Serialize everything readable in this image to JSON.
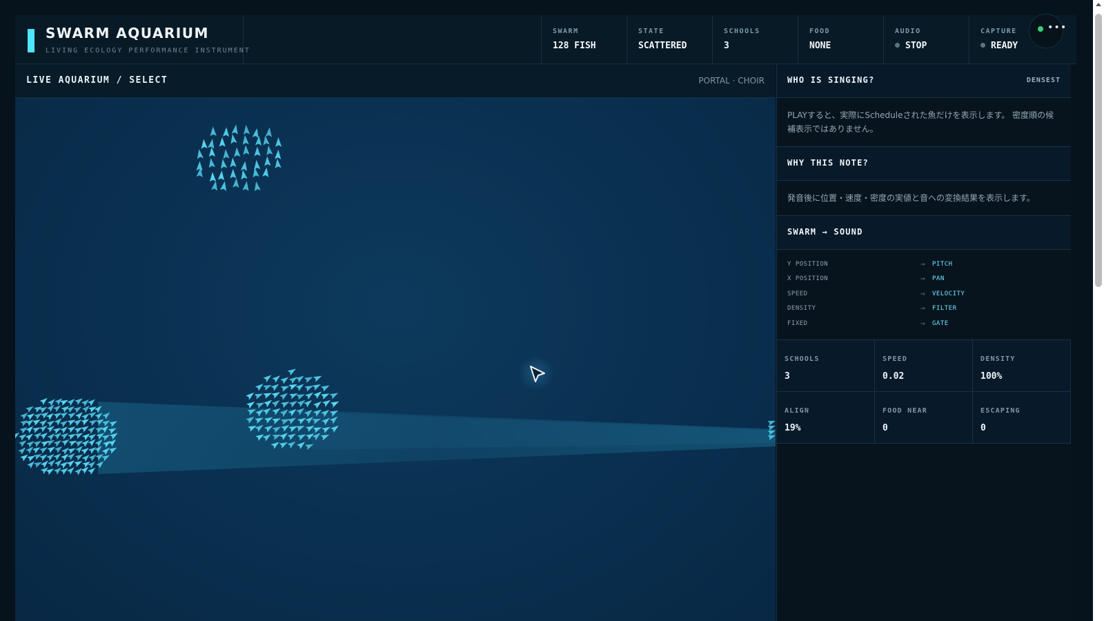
{
  "brand": {
    "title": "SWARM AQUARIUM",
    "subtitle": "LIVING ECOLOGY PERFORMANCE INSTRUMENT"
  },
  "stats": [
    {
      "label": "SWARM",
      "value": "128 FISH"
    },
    {
      "label": "STATE",
      "value": "SCATTERED"
    },
    {
      "label": "SCHOOLS",
      "value": "3"
    },
    {
      "label": "FOOD",
      "value": "NONE"
    },
    {
      "label": "AUDIO",
      "value": "STOP",
      "indicator": "dot-gray"
    },
    {
      "label": "CAPTURE",
      "value": "READY",
      "indicator": "dot-gray"
    }
  ],
  "header_menu": {
    "icon": "more-horizontal-icon",
    "status_color": "#33d17a"
  },
  "aquarium": {
    "title": "LIVE AQUARIUM / SELECT",
    "mode": "PORTAL · CHOIR",
    "cursor_icon": "pointer-cursor-icon"
  },
  "panel": {
    "who": {
      "title": "WHO IS SINGING?",
      "right": "DENSEST",
      "text": "PLAYすると、実際にScheduleされた魚だけを表示します。 密度順の候補表示ではありません。"
    },
    "why": {
      "title": "WHY THIS NOTE?",
      "text": "発音後に位置・速度・密度の実値と音への変換結果を表示します。"
    },
    "mapping": {
      "title": "SWARM → SOUND",
      "rows": [
        {
          "source": "Y POSITION",
          "target": "PITCH"
        },
        {
          "source": "X POSITION",
          "target": "PAN"
        },
        {
          "source": "SPEED",
          "target": "VELOCITY"
        },
        {
          "source": "DENSITY",
          "target": "FILTER"
        },
        {
          "source": "FIXED",
          "target": "GATE"
        }
      ]
    },
    "metrics": [
      {
        "label": "SCHOOLS",
        "value": "3"
      },
      {
        "label": "SPEED",
        "value": "0.02"
      },
      {
        "label": "DENSITY",
        "value": "100%"
      },
      {
        "label": "ALIGN",
        "value": "19%"
      },
      {
        "label": "FOOD NEAR",
        "value": "0"
      },
      {
        "label": "ESCAPING",
        "value": "0"
      }
    ]
  },
  "colors": {
    "accent": "#4ee6ff",
    "fish": "#57d8f5",
    "water": "#0a3152"
  }
}
